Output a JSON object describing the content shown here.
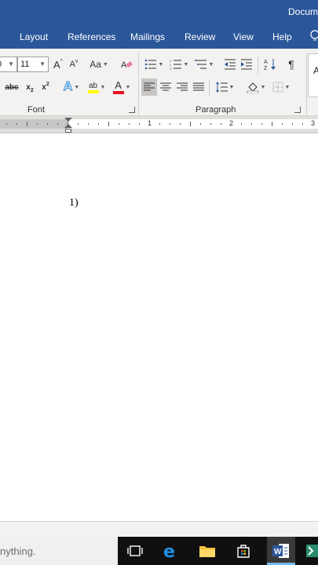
{
  "window": {
    "title": "Docum"
  },
  "tabs": [
    {
      "label": "Layout"
    },
    {
      "label": "References"
    },
    {
      "label": "Mailings"
    },
    {
      "label": "Review"
    },
    {
      "label": "View"
    },
    {
      "label": "Help"
    }
  ],
  "font_group": {
    "label": "Font",
    "font_name_value": "0",
    "font_size_value": "11",
    "grow_label": "A",
    "shrink_label": "A",
    "case_label": "Aa",
    "strike_label": "abc",
    "sub_label": "x",
    "sup_label": "x",
    "effects_label": "A",
    "highlight_label": "ab",
    "color_label": "A",
    "highlight_color": "#ffff00",
    "font_color": "#e81123"
  },
  "paragraph_group": {
    "label": "Paragraph",
    "pilcrow": "¶"
  },
  "styles_group": {
    "preview": "A"
  },
  "ruler": {
    "numbers": [
      "1",
      "2",
      "3"
    ]
  },
  "document": {
    "list_number": "1)"
  },
  "taskbar": {
    "search_text": "nything."
  },
  "colors": {
    "brand": "#2b579a",
    "taskbar": "#101010",
    "accent": "#76b9ed"
  }
}
